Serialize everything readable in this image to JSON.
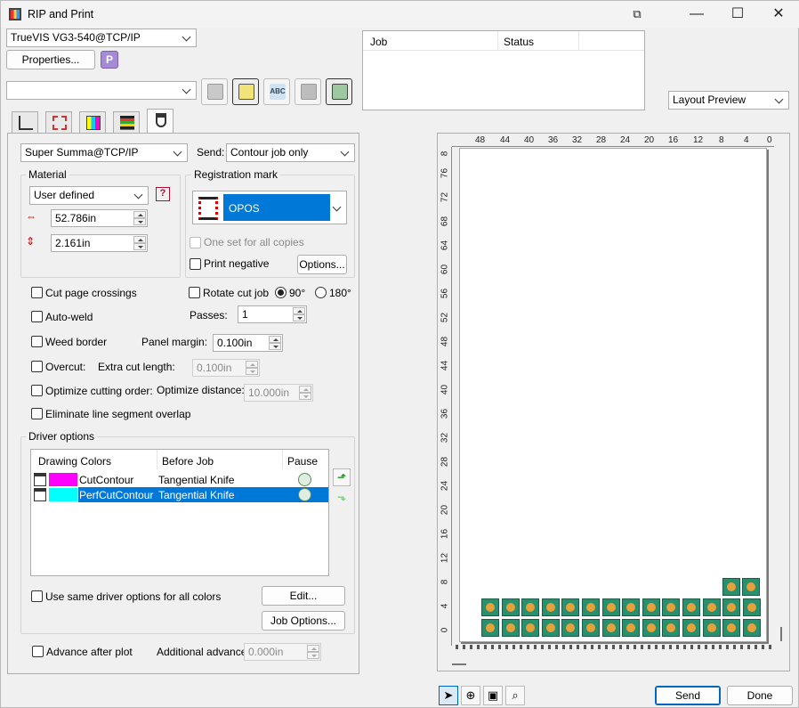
{
  "window": {
    "title": "RIP and Print",
    "controls": {
      "restore": "⧉",
      "minimize": "—",
      "maximize": "☐",
      "close": "✕"
    }
  },
  "top": {
    "printer_combo": "TrueVIS VG3-540@TCP/IP",
    "properties_label": "Properties...",
    "preset_combo": "",
    "layout_combo": "Layout Preview"
  },
  "job_table": {
    "headers": [
      "Job",
      "Status"
    ]
  },
  "cutter": {
    "device_combo": "Super Summa@TCP/IP",
    "send_label": "Send:",
    "send_combo": "Contour job only"
  },
  "material": {
    "label": "Material",
    "type_combo": "User defined",
    "width": "52.786in",
    "height": "2.161in"
  },
  "registration": {
    "label": "Registration mark",
    "mark_combo": "OPOS",
    "one_set_label": "One set for all copies",
    "print_negative_label": "Print negative",
    "options_label": "Options..."
  },
  "options": {
    "cut_page_crossings": "Cut page crossings",
    "rotate_cut_job": "Rotate cut job",
    "rot_90": "90°",
    "rot_180": "180°",
    "auto_weld": "Auto-weld",
    "passes_label": "Passes:",
    "passes_value": "1",
    "weed_border": "Weed border",
    "panel_margin_label": "Panel margin:",
    "panel_margin_value": "0.100in",
    "overcut": "Overcut:",
    "extra_cut_label": "Extra cut length:",
    "extra_cut_value": "0.100in",
    "optimize_order": "Optimize cutting order:",
    "optimize_distance_label": "Optimize distance:",
    "optimize_distance_value": "10.000in",
    "eliminate_overlap": "Eliminate line segment overlap"
  },
  "driver": {
    "label": "Driver options",
    "headers": [
      "Drawing Colors",
      "Before Job",
      "Pause"
    ],
    "rows": [
      {
        "name": "CutContour",
        "before": "Tangential Knife",
        "swatch": "#ff00ff",
        "selected": false
      },
      {
        "name": "PerfCutContour",
        "before": "Tangential Knife",
        "swatch": "#00ffff",
        "selected": true
      }
    ],
    "same_options_label": "Use same driver options for all colors",
    "edit_label": "Edit...",
    "job_options_label": "Job Options..."
  },
  "advance": {
    "advance_label": "Advance after plot",
    "additional_label": "Additional advance:",
    "additional_value": "0.000in"
  },
  "preview": {
    "h_ticks": [
      "48",
      "44",
      "40",
      "36",
      "32",
      "28",
      "24",
      "20",
      "16",
      "12",
      "8",
      "4",
      "0"
    ],
    "v_ticks": [
      "8",
      "76",
      "72",
      "68",
      "64",
      "60",
      "56",
      "52",
      "48",
      "44",
      "40",
      "36",
      "32",
      "28",
      "24",
      "20",
      "16",
      "12",
      "8",
      "4",
      "0"
    ]
  },
  "footer": {
    "send_label": "Send",
    "done_label": "Done"
  },
  "colors": {
    "selection": "#0078d7",
    "accent": "#0067c0"
  }
}
